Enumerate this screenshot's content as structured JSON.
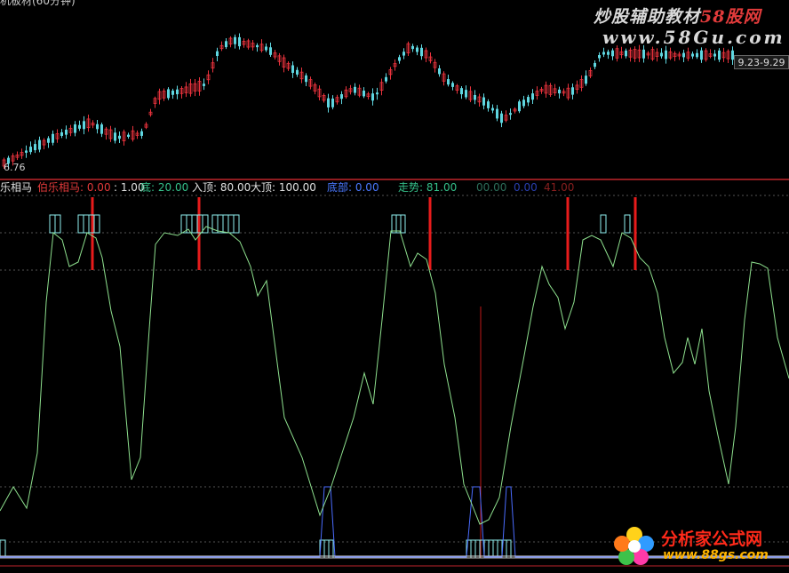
{
  "window": {
    "title_fragment": "机板材(60分钟)"
  },
  "watermark": {
    "line1_text": "炒股辅助教材",
    "line1_site": "58股网",
    "line2": "www.58Gu.com"
  },
  "price_panel": {
    "date_range": "9.23-9.29",
    "low_price_label": "6.76"
  },
  "indicator_header": {
    "name": "乐相马",
    "items": [
      {
        "label": "伯乐相马:",
        "value": "0.00",
        "color": "#e33a3a"
      },
      {
        "label": "",
        "value": ": 1.00",
        "color": "#e0e0e0"
      },
      {
        "label": "底:",
        "value": "20.00",
        "color": "#35c08a"
      },
      {
        "label": "入顶:",
        "value": "80.00",
        "color": "#e0e0e0"
      },
      {
        "label": "大顶:",
        "value": "100.00",
        "color": "#e0e0e0"
      },
      {
        "label": "底部:",
        "value": "0.00",
        "color": "#4a78ff"
      },
      {
        "label": "走势:",
        "value": "81.00",
        "color": "#35c08a"
      },
      {
        "label": "",
        "value": "00.00",
        "color": "#2d6e5a"
      },
      {
        "label": "",
        "value": "0.00",
        "color": "#2a3fb0"
      },
      {
        "label": "",
        "value": "41.00",
        "color": "#8a1f1f"
      }
    ]
  },
  "logo": {
    "title": "分析家公式网",
    "url": "www.88gs.com"
  },
  "colors": {
    "bull": "#e8323c",
    "bear": "#5fd6e0",
    "trend": "#8ee08e",
    "signal": "#e81b1b",
    "bottom": "#4a6cff",
    "box": "#8ff0ef"
  }
}
